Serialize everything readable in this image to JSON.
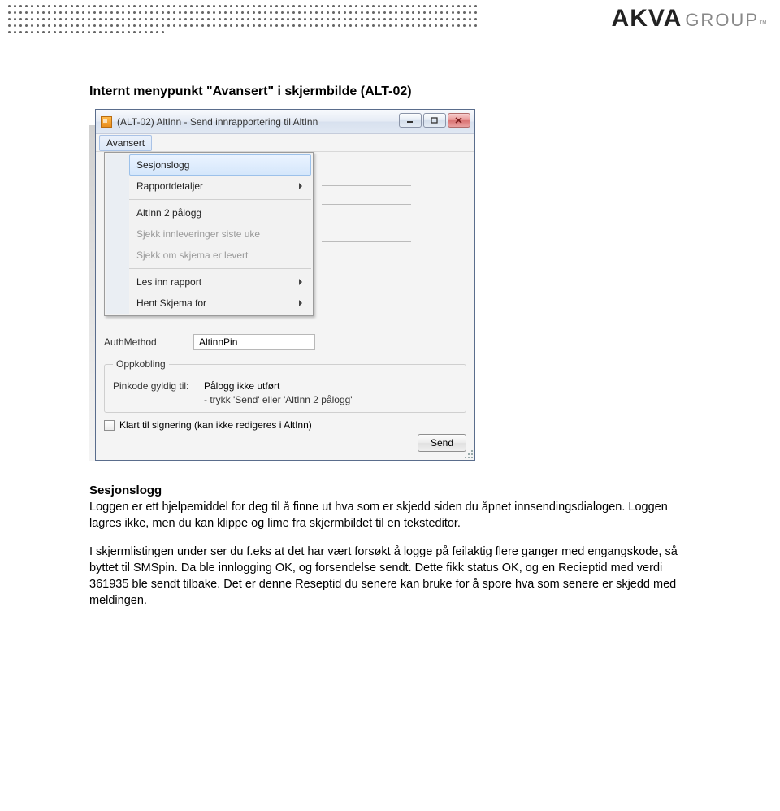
{
  "logo": {
    "brand": "AKVA",
    "suffix": "GROUP",
    "tm": "™"
  },
  "doc": {
    "title": "Internt menypunkt \"Avansert\" i skjermbilde (ALT-02)",
    "section_heading": "Sesjonslogg",
    "para1": "Loggen er ett hjelpemiddel for deg til å finne ut hva som er skjedd siden du åpnet innsendingsdialogen. Loggen lagres ikke, men du kan klippe og lime fra skjermbildet til en teksteditor.",
    "para2": "I skjermlistingen under ser du f.eks at det har vært forsøkt å logge på feilaktig flere ganger med engangskode, så byttet til SMSpin. Da ble innlogging OK, og forsendelse sendt. Dette fikk status OK, og en Recieptid med verdi 361935 ble sendt tilbake. Det er denne Reseptid du senere kan bruke for å spore hva som senere er skjedd med meldingen."
  },
  "window": {
    "title": "(ALT-02) AltInn - Send innrapportering til AltInn",
    "menu": {
      "avansert": "Avansert"
    },
    "dropdown": {
      "sesjonslogg": "Sesjonslogg",
      "rapportdetaljer": "Rapportdetaljer",
      "altinn2palogg": "AltInn 2 pålogg",
      "sjekk_innleveringer": "Sjekk innleveringer siste uke",
      "sjekk_skjema_levert": "Sjekk om skjema er levert",
      "les_inn_rapport": "Les inn rapport",
      "hent_skjema_for": "Hent Skjema for"
    },
    "fields": {
      "authmethod_label": "AuthMethod",
      "authmethod_value": "AltinnPin"
    },
    "oppkobling": {
      "legend": "Oppkobling",
      "pin_label": "Pinkode gyldig til:",
      "pin_status1": "Pålogg ikke utført",
      "pin_status2": "- trykk 'Send' eller 'AltInn 2 pålogg'"
    },
    "checkbox_label": "Klart til signering (kan ikke redigeres i AltInn)",
    "send_button": "Send"
  }
}
